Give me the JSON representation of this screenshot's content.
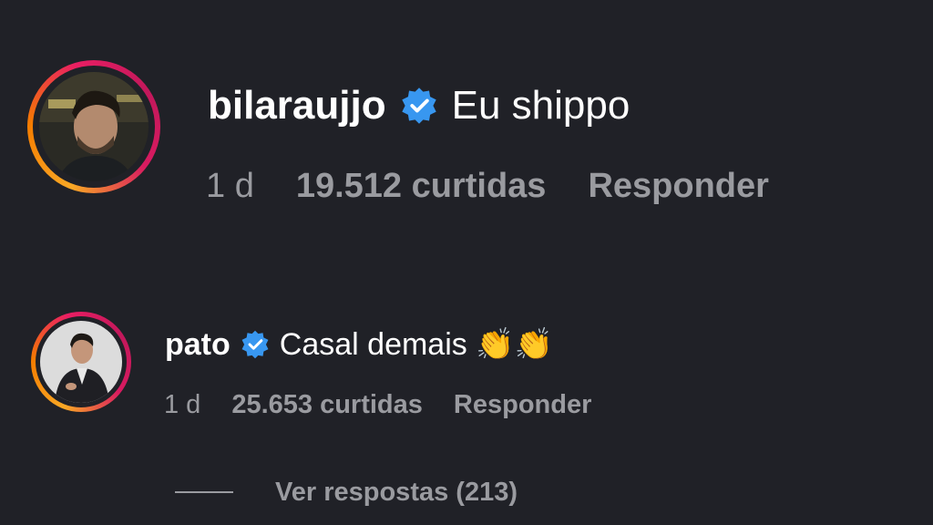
{
  "colors": {
    "background": "#202127",
    "text_primary": "#ffffff",
    "text_secondary": "#9a9ba0",
    "verified_badge": "#3897f0"
  },
  "comments": [
    {
      "username": "bilaraujjo",
      "verified": true,
      "text": "Eu shippo",
      "time": "1 d",
      "likes": "19.512 curtidas",
      "reply_label": "Responder",
      "avatar_icon": "story-ring-avatar"
    },
    {
      "username": "pato",
      "verified": true,
      "text": "Casal demais 👏👏",
      "time": "1 d",
      "likes": "25.653 curtidas",
      "reply_label": "Responder",
      "avatar_icon": "story-ring-avatar"
    }
  ],
  "replies": {
    "label": "Ver respostas (213)"
  }
}
